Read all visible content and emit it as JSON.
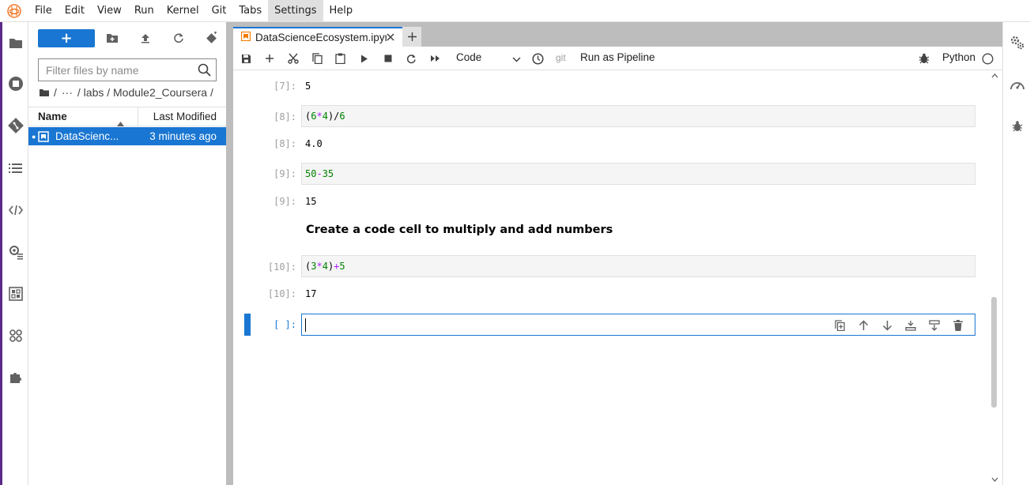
{
  "menubar": {
    "items": [
      "File",
      "Edit",
      "View",
      "Run",
      "Kernel",
      "Git",
      "Tabs",
      "Settings",
      "Help"
    ],
    "active": "Settings"
  },
  "filebrowser": {
    "new_label": "+",
    "filter_placeholder": "Filter files by name",
    "breadcrumb": [
      "/",
      "···",
      "/ labs / Module2_Coursera /"
    ],
    "columns": {
      "name": "Name",
      "modified": "Last Modified"
    },
    "files": [
      {
        "dot": "●",
        "name": "DataScienc...",
        "modified": "3 minutes ago"
      }
    ]
  },
  "tabs": [
    {
      "label": "DataScienceEcosystem.ipyn"
    }
  ],
  "toolbar": {
    "cell_type": "Code",
    "git_label": "git",
    "pipeline_label": "Run as Pipeline",
    "kernel_label": "Python"
  },
  "cells": {
    "c7": {
      "out_prompt": "[7]:",
      "output": "5"
    },
    "c8": {
      "in_prompt": "[8]:",
      "code_a": "(",
      "code_b": "6",
      "code_c": "*",
      "code_d": "4",
      "code_e": ")/",
      "code_f": "6",
      "out_prompt": "[8]:",
      "output": "4.0"
    },
    "c9": {
      "in_prompt": "[9]:",
      "code_a": "50",
      "code_b": "-",
      "code_c": "35",
      "out_prompt": "[9]:",
      "output": "15"
    },
    "markdown": "Create a code cell to multiply and add numbers",
    "c10": {
      "in_prompt": "[10]:",
      "code_a": "(",
      "code_b": "3",
      "code_c": "*",
      "code_d": "4",
      "code_e": ")",
      "code_f": "+",
      "code_g": "5",
      "out_prompt": "[10]:",
      "output": "17"
    },
    "empty": {
      "in_prompt": "[ ]:"
    }
  },
  "colors": {
    "accent": "#1976d2",
    "left_strip": "#5b2a86",
    "number": "#008000",
    "operator": "#aa22ff"
  }
}
